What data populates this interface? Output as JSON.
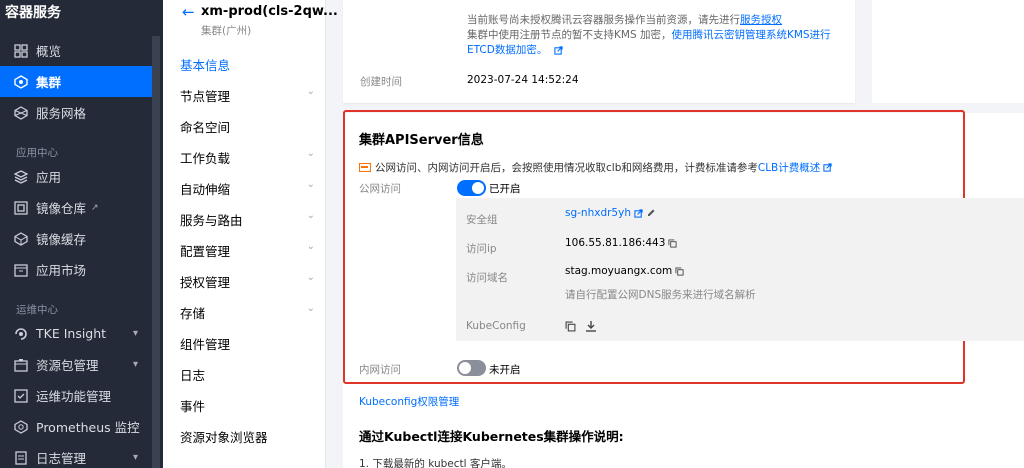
{
  "sidebar": {
    "brand": "容器服务",
    "items": [
      {
        "label": "概览"
      },
      {
        "label": "集群"
      },
      {
        "label": "服务网格"
      },
      {
        "label": "应用"
      },
      {
        "label": "镜像仓库"
      },
      {
        "label": "镜像缓存"
      },
      {
        "label": "应用市场"
      },
      {
        "label": "TKE Insight"
      },
      {
        "label": "资源包管理"
      },
      {
        "label": "运维功能管理"
      },
      {
        "label": "Prometheus 监控"
      },
      {
        "label": "日志管理"
      }
    ],
    "sections": [
      "应用中心",
      "运维中心"
    ]
  },
  "subnav": {
    "title": "xm-prod(cls-2qw...",
    "subtitle": "集群(广州)",
    "items": [
      {
        "label": "基本信息"
      },
      {
        "label": "节点管理"
      },
      {
        "label": "命名空间"
      },
      {
        "label": "工作负载"
      },
      {
        "label": "自动伸缩"
      },
      {
        "label": "服务与路由"
      },
      {
        "label": "配置管理"
      },
      {
        "label": "授权管理"
      },
      {
        "label": "存储"
      },
      {
        "label": "组件管理"
      },
      {
        "label": "日志"
      },
      {
        "label": "事件"
      },
      {
        "label": "资源对象浏览器"
      }
    ]
  },
  "top_card": {
    "note1_prefix": "当前账号尚未授权腾讯云容器服务操作当前资源，请先进行",
    "note1_link": "服务授权",
    "note2_prefix": "集群中使用注册节点的暂不支持KMS 加密，",
    "note2_link": "使用腾讯云密钥管理系统KMS进行",
    "note3_link": "ETCD数据加密。",
    "created_label": "创建时间",
    "created_value": "2023-07-24 14:52:24"
  },
  "apiserver": {
    "title": "集群APIServer信息",
    "warning_text": "公网访问、内网访问开启后，会按照使用情况收取clb和网络费用，计费标准请参考",
    "warning_link": "CLB计费概述",
    "public_label": "公网访问",
    "public_status": "已开启",
    "sg_label": "安全组",
    "sg_value": "sg-nhxdr5yh",
    "ip_label": "访问ip",
    "ip_value": "106.55.81.186:443",
    "domain_label": "访问域名",
    "domain_value": "stag.moyuangx.com",
    "domain_hint": "请自行配置公网DNS服务来进行域名解析",
    "kubeconfig_label": "KubeConfig",
    "private_label": "内网访问",
    "private_status": "未开启"
  },
  "kubeconfig_link": "Kubeconfig权限管理",
  "bottom": {
    "title": "通过Kubectl连接Kubernetes集群操作说明:",
    "step1": "1. 下载最新的 kubectl 客户端。"
  },
  "colors": {
    "accent": "#006eff",
    "highlight_border": "#e0332a",
    "sidebar_bg": "#242a37"
  }
}
